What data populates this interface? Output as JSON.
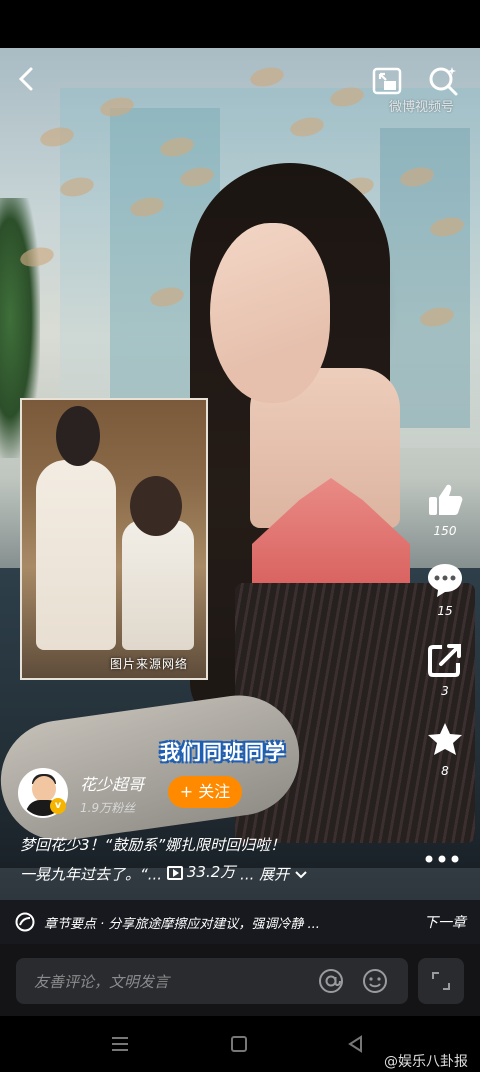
{
  "watermark": "微博视频号",
  "inset_caption": "图片来源网络",
  "subtitle": "我们同班同学",
  "author": {
    "name": "花少超哥",
    "fans": "1.9万粉丝",
    "verified_badge": "v",
    "follow_label": "+ 关注"
  },
  "description": {
    "line1": "梦回花少3！“鼓励系”娜扎限时回归啦！",
    "line2": "一晃九年过去了。“...",
    "views": "33.2万",
    "expand": "... 展开"
  },
  "actions": {
    "like_count": "150",
    "comment_count": "15",
    "share_count": "3",
    "favorite_count": "8"
  },
  "chapter": {
    "text": "章节要点 · 分享旅途摩擦应对建议，强调冷静 ...",
    "next_label": "下一章"
  },
  "comment": {
    "placeholder": "友善评论，文明发言"
  },
  "brand_watermark": "@娱乐八卦报",
  "colors": {
    "follow_button": "#ff8a00",
    "verified_badge": "#f5b400",
    "subtitle_outline": "#1e5fb3"
  }
}
